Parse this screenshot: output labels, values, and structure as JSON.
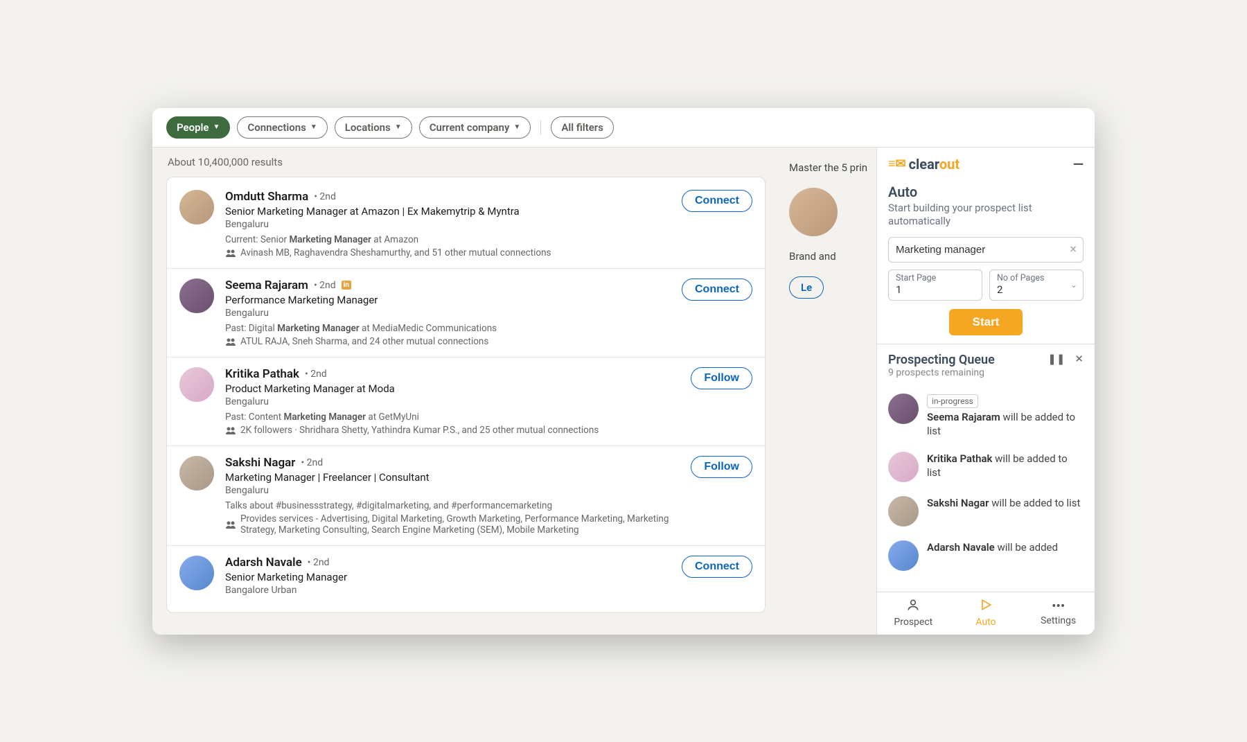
{
  "filters": {
    "people": "People",
    "connections": "Connections",
    "locations": "Locations",
    "current_company": "Current company",
    "all_filters": "All filters"
  },
  "results_summary": "About 10,400,000 results",
  "results": [
    {
      "name": "Omdutt Sharma",
      "degree": "2nd",
      "headline": "Senior Marketing Manager at Amazon | Ex Makemytrip & Myntra",
      "location": "Bengaluru",
      "meta_prefix": "Current: Senior ",
      "meta_bold": "Marketing Manager",
      "meta_suffix": " at Amazon",
      "mutual": "Avinash MB, Raghavendra Sheshamurthy, and 51 other mutual connections",
      "action": "Connect",
      "premium": false
    },
    {
      "name": "Seema Rajaram",
      "degree": "2nd",
      "headline": "Performance Marketing Manager",
      "location": "Bengaluru",
      "meta_prefix": "Past: Digital ",
      "meta_bold": "Marketing Manager",
      "meta_suffix": " at MediaMedic Communications",
      "mutual": "ATUL RAJA, Sneh Sharma, and 24 other mutual connections",
      "action": "Connect",
      "premium": true
    },
    {
      "name": "Kritika Pathak",
      "degree": "2nd",
      "headline": "Product Marketing Manager at Moda",
      "location": "Bengaluru",
      "meta_prefix": "Past: Content ",
      "meta_bold": "Marketing Manager",
      "meta_suffix": " at GetMyUni",
      "mutual": "2K followers · Shridhara Shetty, Yathindra Kumar P.S., and 25 other mutual connections",
      "action": "Follow",
      "premium": false
    },
    {
      "name": "Sakshi Nagar",
      "degree": "2nd",
      "headline": "Marketing Manager | Freelancer | Consultant",
      "location": "Bengaluru",
      "meta_prefix": "Talks about #businessstrategy, #digitalmarketing, and #performancemarketing",
      "meta_bold": "",
      "meta_suffix": "",
      "mutual": "Provides services - Advertising, Digital Marketing, Growth Marketing, Performance Marketing, Marketing Strategy, Marketing Consulting, Search Engine Marketing (SEM), Mobile Marketing",
      "action": "Follow",
      "premium": false
    },
    {
      "name": "Adarsh Navale",
      "degree": "2nd",
      "headline": "Senior Marketing Manager",
      "location": "Bangalore Urban",
      "meta_prefix": "",
      "meta_bold": "",
      "meta_suffix": "",
      "mutual": "",
      "action": "Connect",
      "premium": false
    }
  ],
  "ad": {
    "line1": "Master the 5 prin",
    "line2": "Brand and",
    "btn": "Le"
  },
  "ext": {
    "brand_clear": "clear",
    "brand_out": "out",
    "auto": {
      "title": "Auto",
      "subtitle": "Start building your prospect list automatically",
      "search_value": "Marketing manager",
      "start_page_label": "Start Page",
      "start_page_value": "1",
      "pages_label": "No of Pages",
      "pages_value": "2",
      "start_btn": "Start"
    },
    "queue": {
      "title": "Prospecting Queue",
      "remaining": "9 prospects remaining",
      "items": [
        {
          "badge": "in-progress",
          "name": "Seema Rajaram",
          "suffix": " will be added to list"
        },
        {
          "badge": "",
          "name": "Kritika Pathak",
          "suffix": " will be added to list"
        },
        {
          "badge": "",
          "name": "Sakshi Nagar",
          "suffix": " will be added to list"
        },
        {
          "badge": "",
          "name": "Adarsh Navale",
          "suffix": " will be added"
        }
      ]
    },
    "nav": {
      "prospect": "Prospect",
      "auto": "Auto",
      "settings": "Settings"
    }
  }
}
